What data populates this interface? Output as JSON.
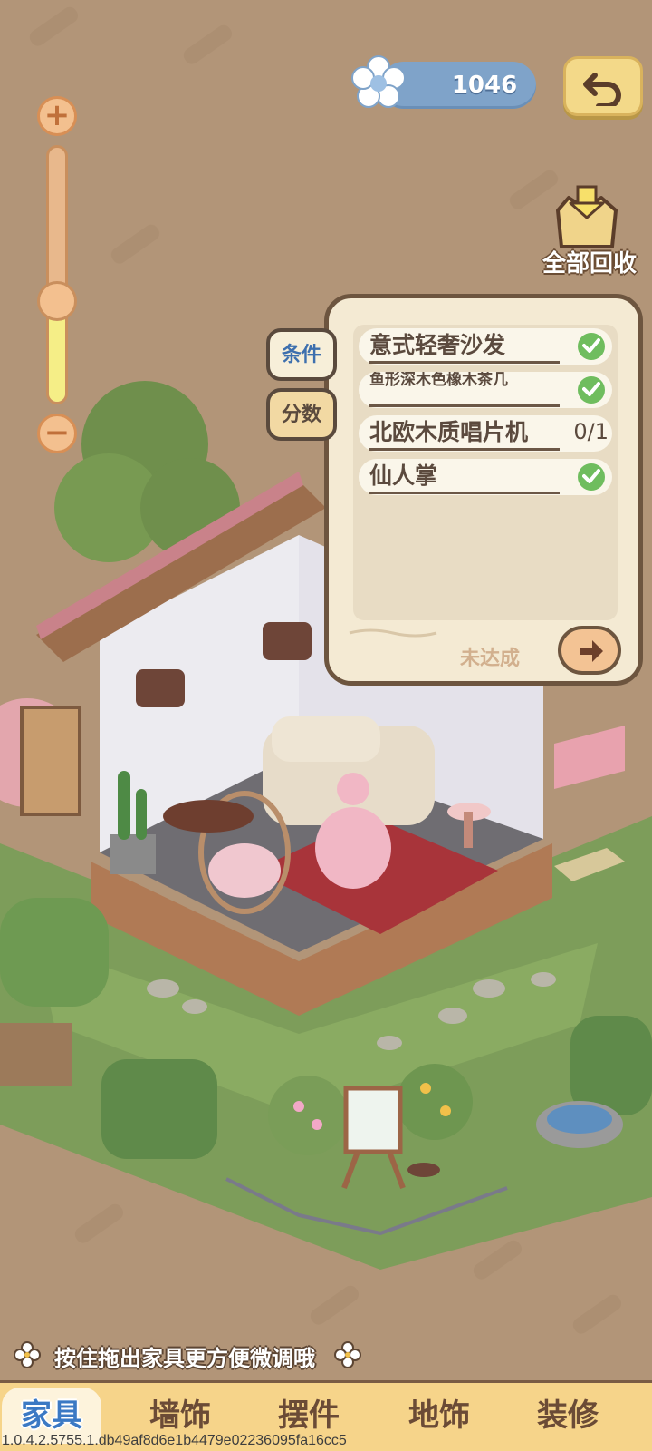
{
  "currency": {
    "value": "1046",
    "icon": "flower-icon"
  },
  "top": {
    "back_icon": "undo-arrow-icon",
    "recycle_label": "全部回收",
    "recycle_icon": "box-with-down-arrow-icon"
  },
  "zoom": {
    "level": 0.4,
    "plus_icon": "plus-icon",
    "minus_icon": "minus-icon"
  },
  "conditions_panel": {
    "tabs": [
      {
        "label": "条件",
        "active": true
      },
      {
        "label": "分数",
        "active": false
      }
    ],
    "items": [
      {
        "label": "意式轻奢沙发",
        "status": "check"
      },
      {
        "label": "鱼形深木色橡木茶几",
        "status": "check"
      },
      {
        "label": "北欧木质唱片机",
        "status": "0/1"
      },
      {
        "label": "仙人掌",
        "status": "check"
      }
    ],
    "state_label": "未达成",
    "next_icon": "arrow-right-icon"
  },
  "hint": {
    "text": "按住拖出家具更方便微调哦"
  },
  "bottom_tabs": [
    {
      "label": "家具",
      "active": true
    },
    {
      "label": "墙饰",
      "active": false
    },
    {
      "label": "摆件",
      "active": false
    },
    {
      "label": "地饰",
      "active": false
    },
    {
      "label": "装修",
      "active": false
    }
  ],
  "version": "1.0.4.2.5755.1.db49af8d6e1b4479e02236095fa16cc5",
  "colors": {
    "background": "#b29578",
    "accent_blue": "#3b79c4",
    "check_green": "#6fbd5e",
    "panel_border": "#6d553f"
  }
}
